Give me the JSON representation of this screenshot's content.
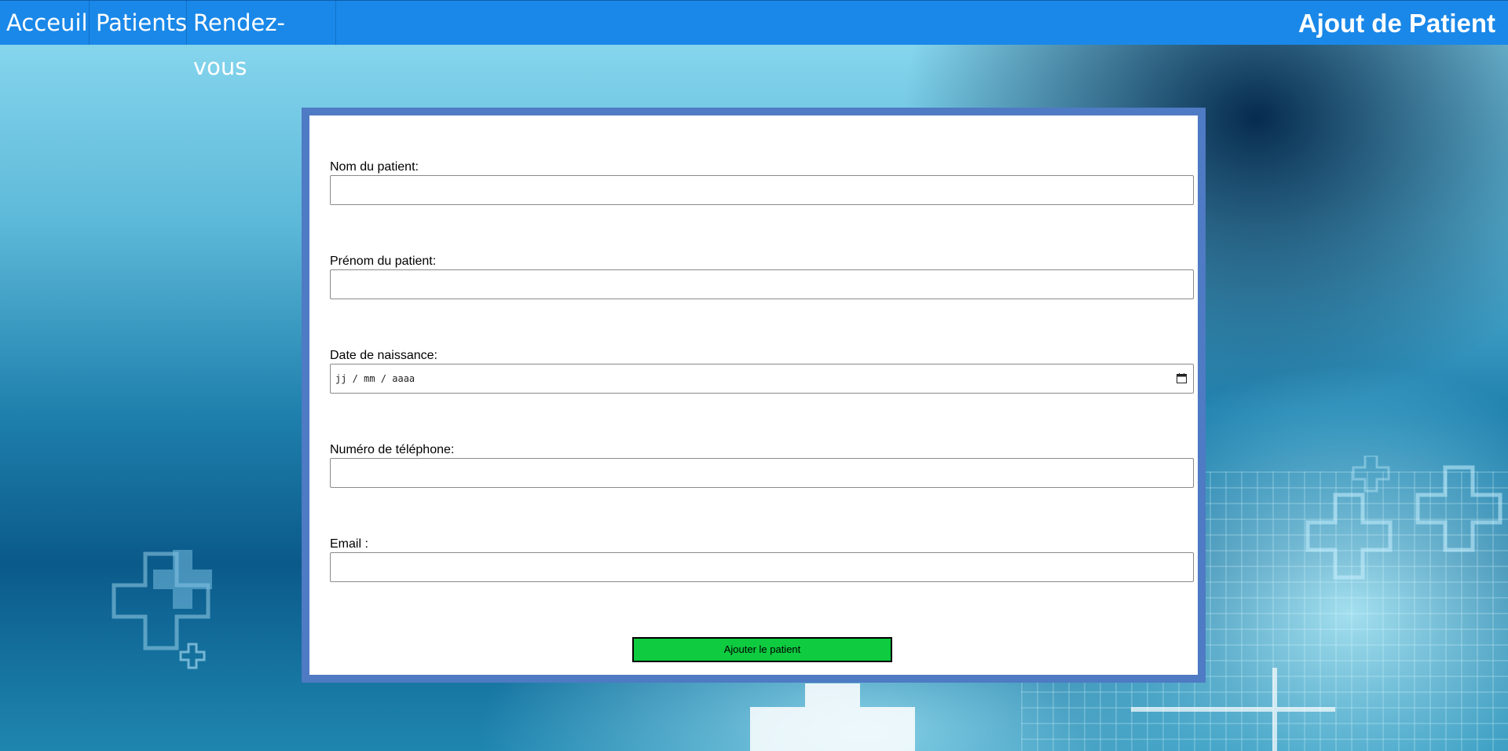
{
  "nav": {
    "items": [
      {
        "label": "Acceuil"
      },
      {
        "label": "Patients"
      },
      {
        "label": "Rendez-vous"
      }
    ],
    "page_title": "Ajout de Patient",
    "bar_color": "#1a88e8"
  },
  "form": {
    "fields": [
      {
        "label": "Nom du patient:",
        "value": "",
        "type": "text"
      },
      {
        "label": "Prénom du patient:",
        "value": "",
        "type": "text"
      },
      {
        "label": "Date de naissance:",
        "placeholder": "jj / mm / aaaa",
        "type": "date"
      },
      {
        "label": "Numéro de téléphone:",
        "value": "",
        "type": "tel"
      },
      {
        "label": "Email :",
        "value": "",
        "type": "email"
      }
    ],
    "submit_label": "Ajouter le patient",
    "submit_color": "#0ecb3f",
    "frame_color": "#4f7ac4"
  },
  "icons": {
    "date_picker": "calendar-icon",
    "background_decor": "medical-cross-icon"
  }
}
